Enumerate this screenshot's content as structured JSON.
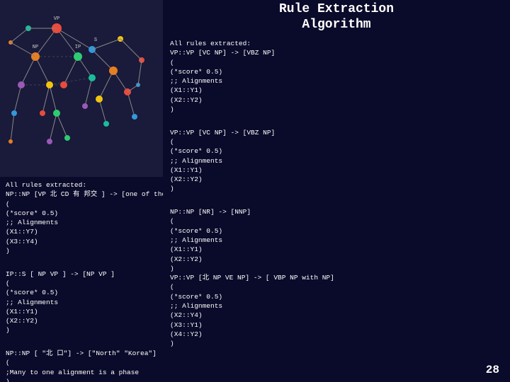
{
  "title": {
    "line1": "Rule Extraction",
    "line2": "Algorithm"
  },
  "left_panel": {
    "rules": [
      {
        "lines": [
          "All rules extracted:",
          "NP::NP [VP 北 CD 有 邦交 ] -> [one of the CD countries that VP]",
          "(",
          "(*score* 0.5)",
          ";; Alignments",
          "(X1::Y7)",
          "(X3::Y4)",
          ")"
        ]
      },
      {
        "lines": [
          "",
          "IP::S [ NP VP ] -> [NP VP ]",
          "(",
          "(*score* 0.5)",
          ";; Alignments",
          "(X1::Y1)",
          "(X2::Y2)",
          ")"
        ]
      },
      {
        "lines": [
          "",
          "NP::NP [ \"北 口\"] -> [\"North\" \"Korea\"]",
          "(",
          ";Many to one alignment is a phase",
          ")"
        ]
      }
    ]
  },
  "right_panel": {
    "rules": [
      {
        "lines": [
          "All rules extracted:",
          "VP::VP [VC NP] -> [VBZ NP]",
          "(",
          "(*score* 0.5)",
          ";; Alignments",
          "(X1::Y1)",
          "(X2::Y2)",
          ")"
        ]
      },
      {
        "lines": [
          "",
          "VP::VP [VC NP] -> [VBZ NP]",
          "(",
          "(*score* 0.5)",
          ";; Alignments",
          "(X1::Y1)",
          "(X2::Y2)",
          ")"
        ]
      },
      {
        "lines": [
          "",
          "NP::NP [NR] -> [NNP]",
          "(",
          "(*score* 0.5)",
          ";; Alignments",
          "(X1::Y1)",
          "(X2::Y2)",
          ")",
          "VP::VP [北 NP VE NP] -> [ VBP NP with NP]",
          "(",
          "(*score* 0.5)",
          ";; Alignments",
          "(X2::Y4)",
          "(X3::Y1)",
          "(X4::Y2)",
          ")"
        ]
      }
    ]
  },
  "page_number": "28"
}
